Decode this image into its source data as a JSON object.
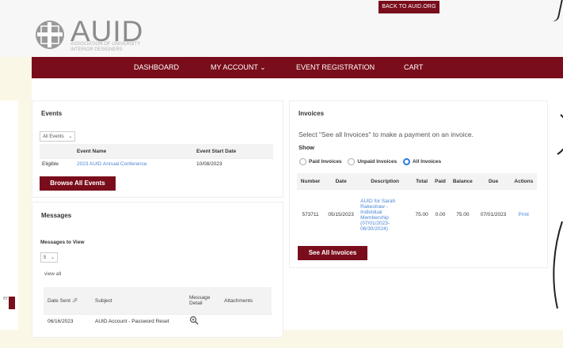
{
  "header": {
    "back_link": "BACK TO AUID.ORG",
    "logo_text": "AUID",
    "logo_sub": "ASSOCIATION OF UNIVERSITY\nINTERIOR DESIGNERS"
  },
  "nav": {
    "items": [
      "DASHBOARD",
      "MY ACCOUNT ⌄",
      "EVENT REGISTRATION",
      "CART"
    ]
  },
  "sidebar": {
    "partial_text": "er"
  },
  "events": {
    "title": "Events",
    "filter_value": "All Events",
    "columns": [
      "",
      "Event Name",
      "Event Start Date"
    ],
    "rows": [
      {
        "status": "Eligible",
        "name": "2023 AUID Annual Conference",
        "date": "10/08/2023"
      }
    ],
    "browse_button": "Browse All Events"
  },
  "messages": {
    "title": "Messages",
    "view_label": "Messages to View",
    "count_value": "5",
    "view_all": "view all",
    "columns": [
      "Date Sent ↓F",
      "Subject",
      "Message Detail",
      "Attachments"
    ],
    "rows": [
      {
        "date": "06/16/2023",
        "subject": "AUID Account - Password Reset"
      }
    ]
  },
  "invoices": {
    "title": "Invoices",
    "instruction": "Select \"See all Invoices\" to make a payment on an invoice.",
    "show_label": "Show",
    "filters": [
      "Paid Invoices",
      "Unpaid Invoices",
      "All Invoices"
    ],
    "selected_filter": "All Invoices",
    "columns": [
      "Number",
      "Date",
      "Description",
      "Total",
      "Paid",
      "Balance",
      "Due",
      "Actions"
    ],
    "rows": [
      {
        "number": "573711",
        "date": "05/15/2023",
        "description": "AUID for Sarah Rakestraw - Individual Membership (07/01/2023-06/30/2024)",
        "total": "75.00",
        "paid": "0.00",
        "balance": "75.00",
        "due": "07/01/2023",
        "action": "Print"
      }
    ],
    "see_all_button": "See All Invoices"
  },
  "colors": {
    "brand": "#7a0d1b",
    "link": "#4a86d8",
    "background": "#fbf7e6"
  }
}
